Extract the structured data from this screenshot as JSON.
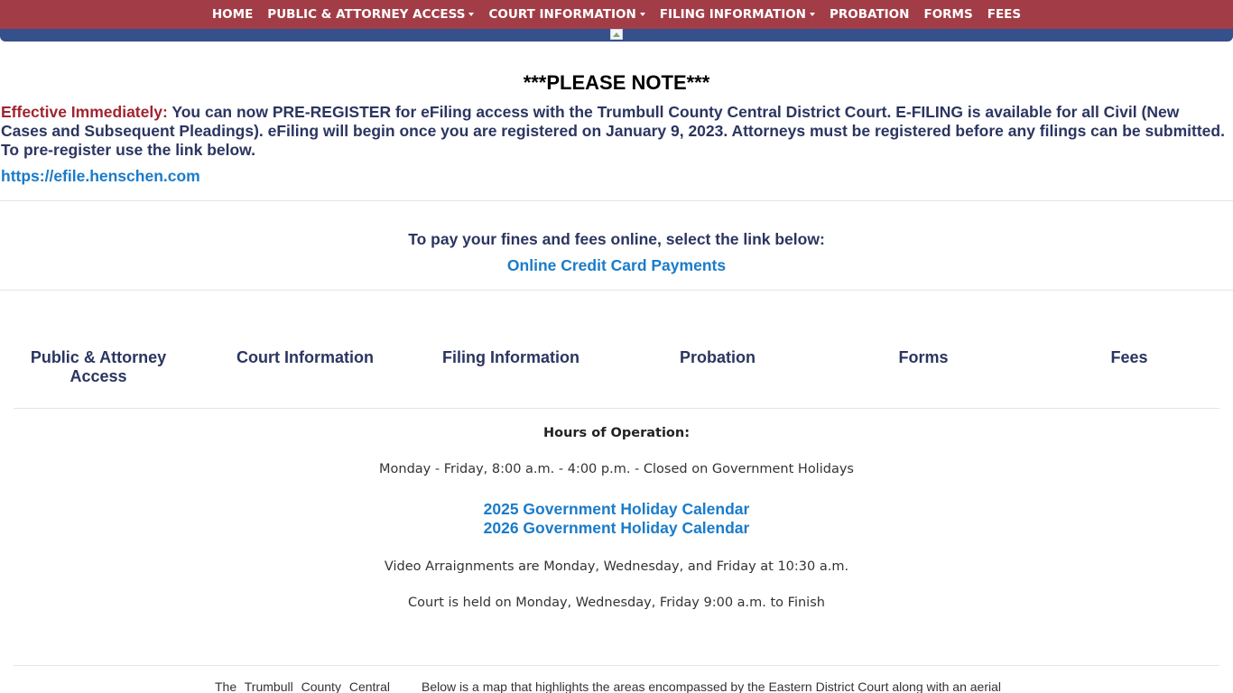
{
  "nav": {
    "items": [
      {
        "label": "HOME",
        "dropdown": false
      },
      {
        "label": "PUBLIC & ATTORNEY ACCESS",
        "dropdown": true
      },
      {
        "label": "COURT INFORMATION",
        "dropdown": true
      },
      {
        "label": "FILING INFORMATION",
        "dropdown": true
      },
      {
        "label": "PROBATION",
        "dropdown": false
      },
      {
        "label": "FORMS",
        "dropdown": false
      },
      {
        "label": "FEES",
        "dropdown": false
      }
    ]
  },
  "notice": {
    "title": "***PLEASE NOTE***",
    "effective_label": "Effective Immediately:",
    "body": " You can now PRE-REGISTER for eFiling access with the Trumbull County Central District Court. E-FILING is available for all Civil (New Cases and Subsequent Pleadings). eFiling will begin once you are registered on January 9, 2023. Attorneys must be registered before any filings can be submitted. To pre-register use the link below.",
    "link": "https://efile.henschen.com"
  },
  "payment": {
    "text": "To pay your fines and fees online, select the link below:",
    "link": "Online Credit Card Payments"
  },
  "quick_links": [
    {
      "label": "Public & Attorney Access"
    },
    {
      "label": "Court Information"
    },
    {
      "label": "Filing Information"
    },
    {
      "label": "Probation"
    },
    {
      "label": "Forms"
    },
    {
      "label": "Fees"
    }
  ],
  "hours": {
    "title": "Hours of Operation:",
    "text": "Monday - Friday, 8:00 a.m. - 4:00 p.m. - Closed on Government Holidays",
    "calendar_2025": "2025 Government Holiday Calendar",
    "calendar_2026": "2026 Government Holiday Calendar",
    "arraignments": "Video Arraignments are Monday, Wednesday, and Friday at 10:30 a.m.",
    "court_held": "Court is held on Monday, Wednesday, Friday 9:00 a.m. to Finish"
  },
  "bottom": {
    "left_text": "The Trumbull County Central",
    "right_text": "Below is a map that highlights the areas encompassed by the Eastern District Court along with an aerial"
  },
  "colors": {
    "nav_bg": "#a23d47",
    "banner_bg": "#35508a",
    "link": "#1a7bc9",
    "heading": "#2b3560",
    "effective": "#a0242f"
  }
}
